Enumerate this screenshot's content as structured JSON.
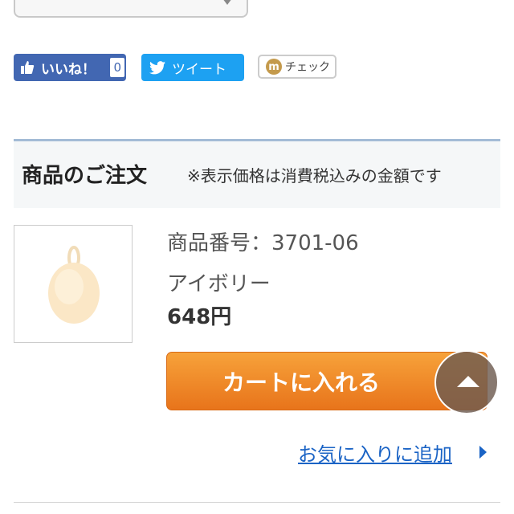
{
  "social": {
    "like_label": "いいね！",
    "like_count": "0",
    "tweet_label": "ツイート",
    "check_icon_letter": "m",
    "check_label": "チェック"
  },
  "order": {
    "title": "商品のご注文",
    "note": "※表示価格は消費税込みの金額です"
  },
  "product": {
    "number": "商品番号：3701-06",
    "color": "アイボリー",
    "price": "648円"
  },
  "cart_button_label": "カートに入れる",
  "favorite_link": "お気に入りに追加",
  "colors": {
    "cart_orange": "#f08a26",
    "link_blue": "#1a63c5",
    "facebook_blue": "#4267b2",
    "twitter_blue": "#1da1f2",
    "header_border": "#a3bbd6"
  }
}
